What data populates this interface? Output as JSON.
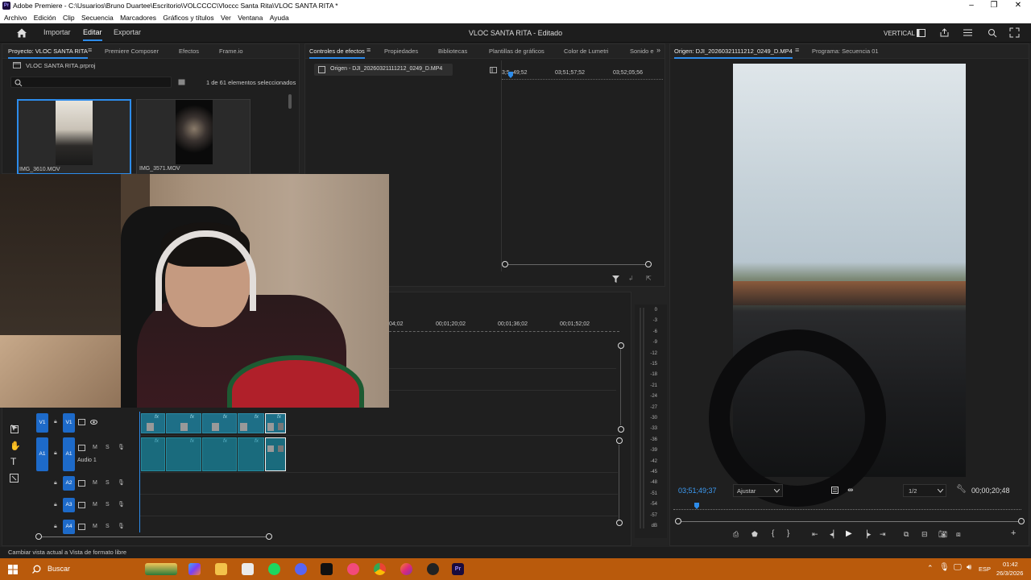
{
  "window": {
    "title": "Adobe Premiere - C:\\Usuarios\\Bruno Duartee\\Escritorio\\VOLCCCC\\Vloccc Santa Rita\\VLOC SANTA RITA *",
    "logo": "Pr",
    "controls": [
      "–",
      "❐",
      "✕"
    ]
  },
  "menu": [
    "Archivo",
    "Edición",
    "Clip",
    "Secuencia",
    "Marcadores",
    "Gráficos y títulos",
    "Ver",
    "Ventana",
    "Ayuda"
  ],
  "appbar": {
    "tabs": [
      "Importar",
      "Editar",
      "Exportar"
    ],
    "active_tab": "Editar",
    "project_title": "VLOC SANTA RITA - Editado",
    "right_label": "VERTICAL"
  },
  "project_panel": {
    "tabs": [
      "Proyecto: VLOC SANTA RITA",
      "Premiere Composer",
      "Efectos",
      "Frame.io"
    ],
    "project_file": "VLOC SANTA RITA.prproj",
    "selection_status": "1 de 61 elementos seleccionados",
    "items": [
      {
        "name": "IMG_3610.MOV"
      },
      {
        "name": "IMG_3571.MOV"
      }
    ]
  },
  "effects_panel": {
    "tabs": [
      "Controles de efectos",
      "Propiedades",
      "Bibliotecas",
      "Plantillas de gráficos",
      "Color de Lumetri",
      "Sonido e"
    ],
    "source_label": "Origen - DJI_20260321111212_0249_D.MP4",
    "ruler": [
      "3;5",
      "49;52",
      "03;51;57;52",
      "03;52;05;56"
    ]
  },
  "timeline": {
    "ruler": [
      "04;02",
      "00;01;20;02",
      "00;01;36;02",
      "00;01;52;02"
    ],
    "tracks": [
      {
        "id": "V1",
        "label": "V1"
      },
      {
        "id": "A1",
        "label": "A1",
        "name": "Audio 1"
      },
      {
        "id": "A2",
        "label": "A2"
      },
      {
        "id": "A3",
        "label": "A3"
      },
      {
        "id": "A4",
        "label": "A4"
      }
    ],
    "track_toggles": [
      "M",
      "S"
    ],
    "fx_label": "fx"
  },
  "meters": {
    "labels": [
      "0",
      "-3",
      "-6",
      "-9",
      "-12",
      "-15",
      "-18",
      "-21",
      "-24",
      "-27",
      "-30",
      "-33",
      "-36",
      "-39",
      "-42",
      "-45",
      "-48",
      "-51",
      "-54",
      "-57",
      "dB"
    ]
  },
  "source_monitor": {
    "tabs": [
      "Origen: DJI_20260321111212_0249_D.MP4",
      "Programa: Secuencia 01"
    ],
    "timecode": "03;51;49;37",
    "fit": "Ajustar",
    "resolution": "1/2",
    "duration": "00;00;20;48"
  },
  "status_text": "Cambiar vista actual a Vista de formato libre",
  "taskbar": {
    "search": "Buscar",
    "lang": "ESP",
    "time": "01:42",
    "date": "26/3/2026"
  },
  "colors": {
    "accent": "#2d8ceb",
    "taskbar": "#b95a0c",
    "clip": "#1e6f87"
  }
}
